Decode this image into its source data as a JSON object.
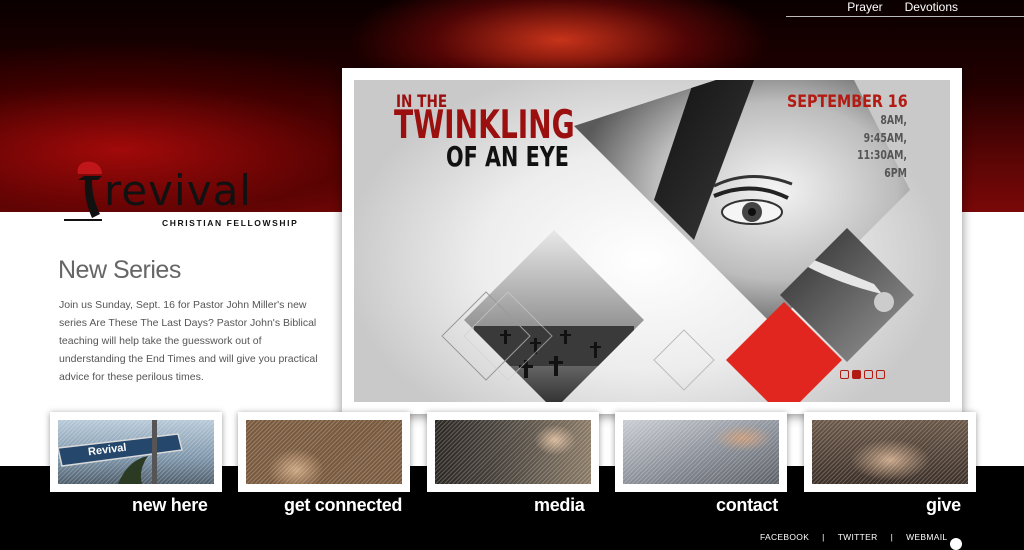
{
  "topnav": {
    "items": [
      "Prayer",
      "Devotions"
    ]
  },
  "logo": {
    "word": "revival",
    "subtitle": "CHRISTIAN FELLOWSHIP"
  },
  "series": {
    "title": "New Series",
    "text": "Join us Sunday, Sept. 16 for Pastor John Miller's new series Are These The Last Days? Pastor John's Biblical teaching will help take the guesswork out of understanding the End Times and will give you practical advice for these perilous times."
  },
  "banner": {
    "title_line1": "IN THE",
    "title_line2": "TWINKLING",
    "title_line3": "OF AN EYE",
    "date": "SEPTEMBER 16",
    "times": [
      "8AM,",
      "9:45AM,",
      "11:30AM,",
      "6PM"
    ],
    "slides": 4,
    "active_slide": 2
  },
  "thumbs": [
    {
      "label": "new here",
      "sign_text": "Revival"
    },
    {
      "label": "get connected"
    },
    {
      "label": "media"
    },
    {
      "label": "contact"
    },
    {
      "label": "give"
    }
  ],
  "footer": {
    "links": [
      "FACEBOOK",
      "TWITTER",
      "WEBMAIL"
    ]
  },
  "colors": {
    "accent": "#b31a12",
    "dark_red": "#9b0f0f"
  }
}
